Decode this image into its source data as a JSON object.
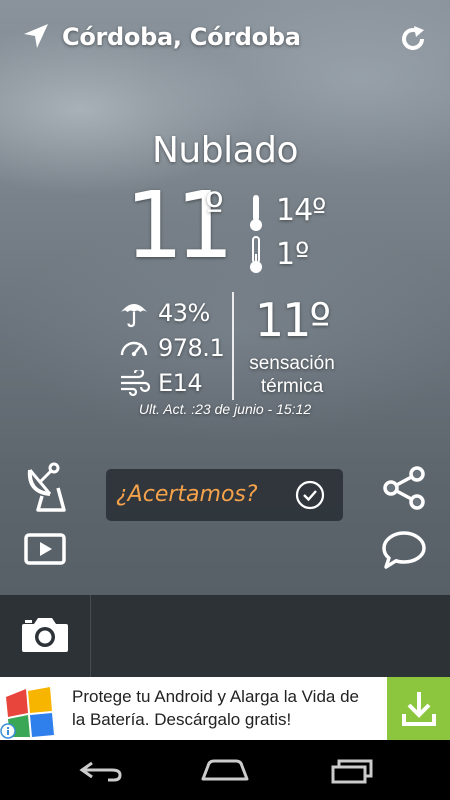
{
  "header": {
    "location": "Córdoba, Córdoba",
    "location_icon": "navigation-arrow-icon",
    "refresh_icon": "refresh-icon"
  },
  "weather": {
    "condition": "Nublado",
    "temperature": "11",
    "degree": "º",
    "max_temp": "14º",
    "min_temp": "1º",
    "rain_probability": "43%",
    "pressure": "978.1",
    "wind": "E14",
    "feels_like": "11º",
    "feels_like_label_1": "sensación",
    "feels_like_label_2": "térmica",
    "updated": "Ult. Act. :23 de junio - 15:12"
  },
  "actions": {
    "feedback_label": "¿Acertamos?",
    "left_icons": [
      "satellite-icon",
      "video-play-icon"
    ],
    "right_icons": [
      "share-icon",
      "comment-icon"
    ]
  },
  "bottom_bar": {
    "camera_icon": "camera-icon"
  },
  "ad": {
    "text": "Protege tu Android y Alarga la Vida de la Batería. Descárgalo gratis!",
    "download_icon": "download-icon",
    "accent_color": "#8cc63f"
  },
  "navbar": {
    "icons": [
      "back-icon",
      "home-icon",
      "recent-apps-icon"
    ]
  },
  "colors": {
    "feedback_text": "#f5a24b",
    "bottom_bar": "#2d3236"
  }
}
